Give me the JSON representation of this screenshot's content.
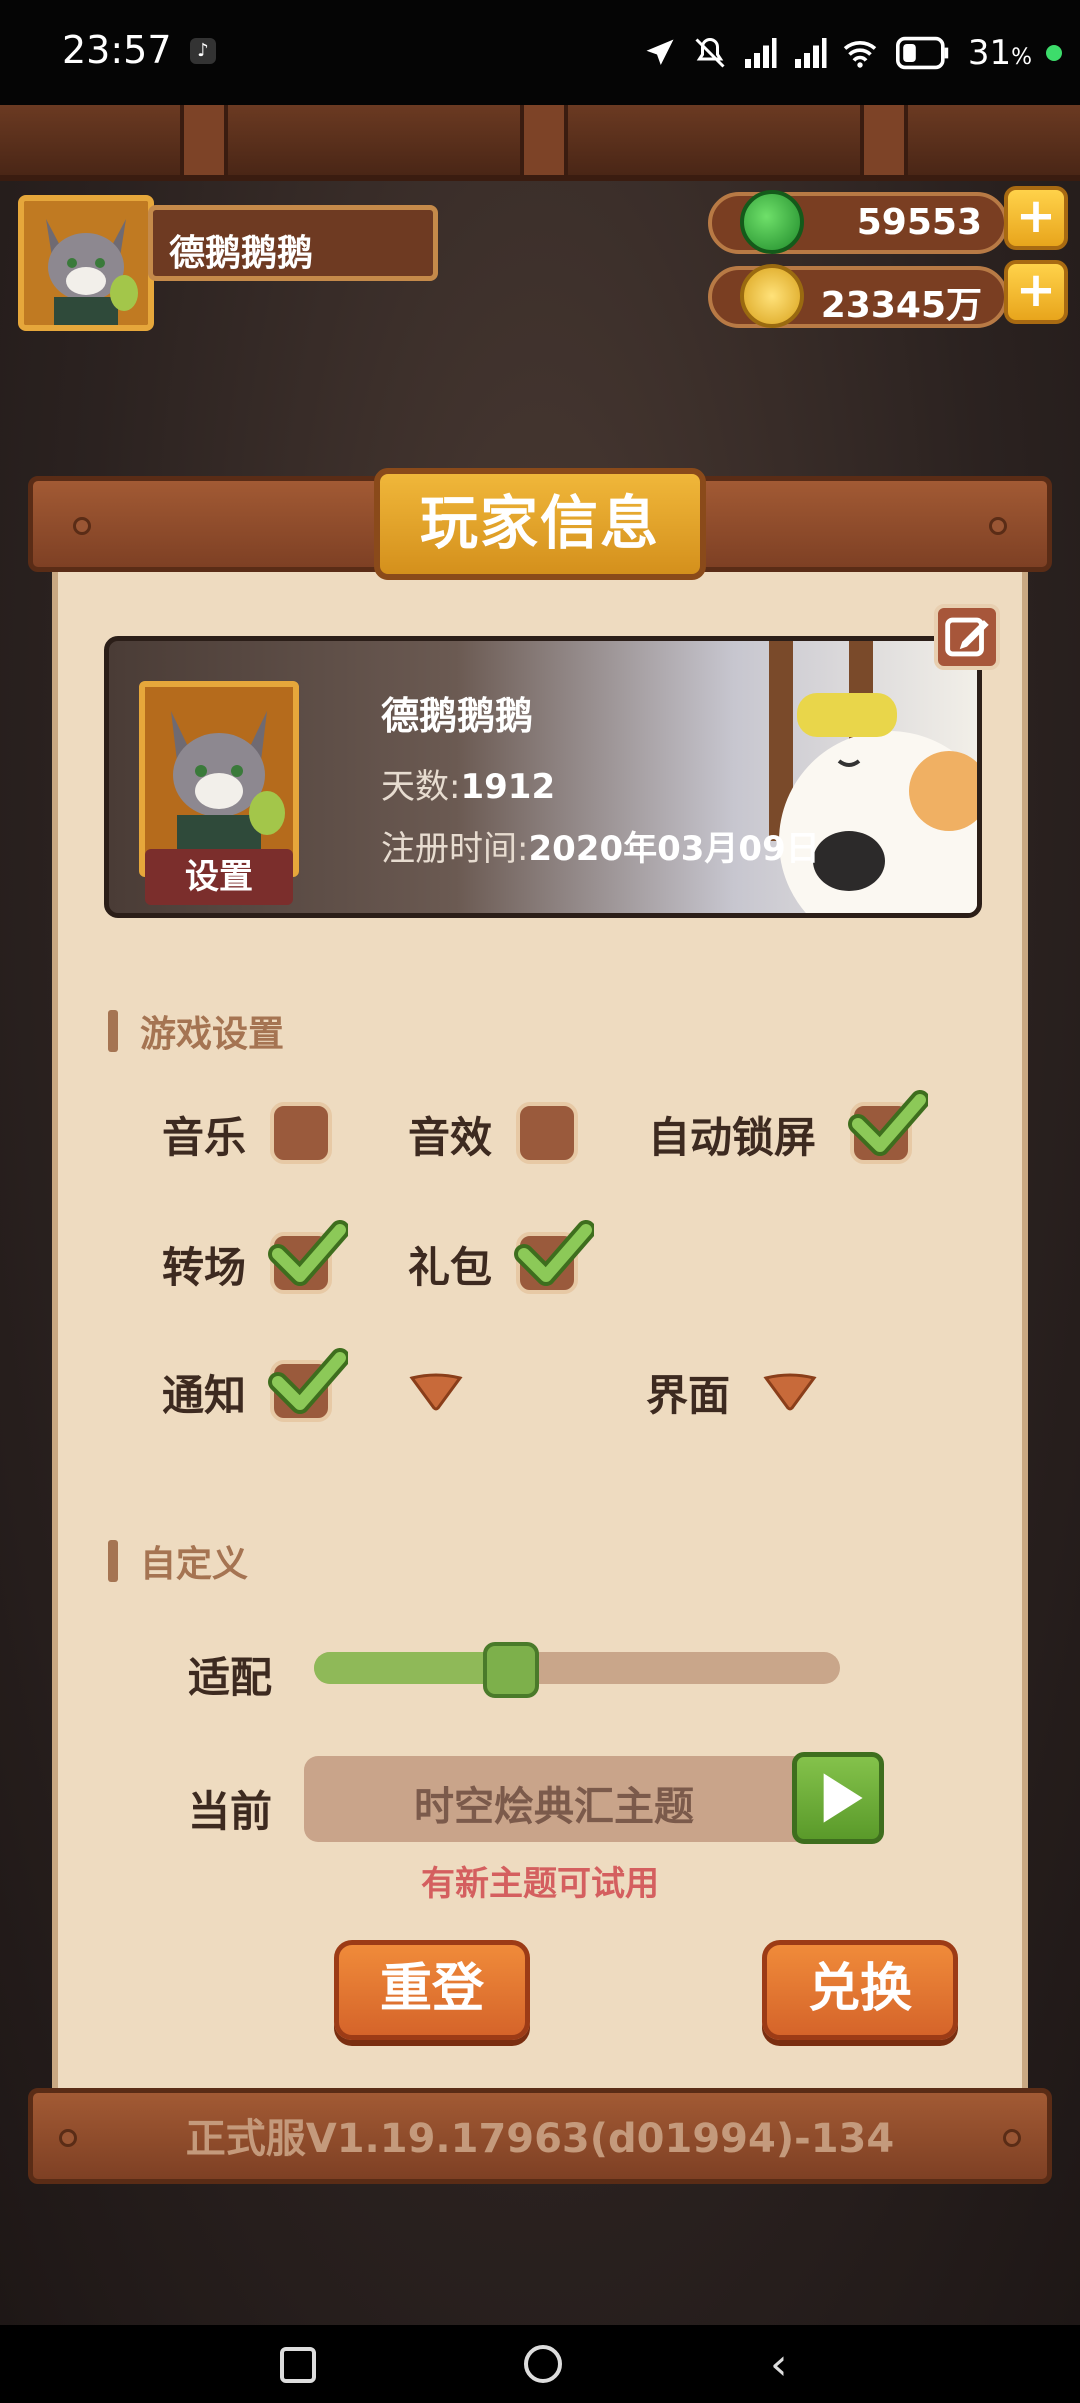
{
  "status_bar": {
    "time": "23:57",
    "battery_percent": "31",
    "battery_unit": "%"
  },
  "player": {
    "name": "德鹅鹅鹅",
    "jade": "59553",
    "coins": "23345万"
  },
  "panel": {
    "title": "玩家信息",
    "profile": {
      "name": "德鹅鹅鹅",
      "days_label": "天数:",
      "days_value": "1912",
      "reg_label": "注册时间:",
      "reg_value": "2020年03月09日",
      "settings_label": "设置"
    },
    "game_settings": {
      "title": "游戏设置",
      "music": "音乐",
      "sfx": "音效",
      "auto_lock": "自动锁屏",
      "transition": "转场",
      "gift": "礼包",
      "notify": "通知",
      "ui": "界面"
    },
    "custom": {
      "title": "自定义",
      "adapt_label": "适配",
      "adapt_value": 0.36,
      "current_label": "当前",
      "theme": "时空烩典汇主题",
      "hint": "有新主题可试用"
    },
    "buttons": {
      "relogin": "重登",
      "redeem": "兑换"
    },
    "version": "正式服V1.19.17963(d01994)-134"
  },
  "colors": {
    "accent_orange": "#e8782e",
    "check_green": "#7db04b",
    "panel_bg": "#eedbc0"
  }
}
